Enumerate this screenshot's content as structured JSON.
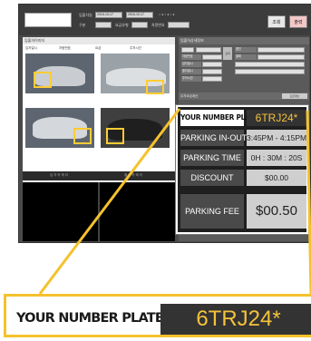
{
  "toolbar": {
    "date_from": "2016-10-17",
    "date_to": "2016-10-17",
    "radio_options": [
      "입차",
      "출차",
      "미정산",
      "정산완료",
      "할인"
    ],
    "search_label": "조회",
    "export_label": "출력"
  },
  "left_panel": {
    "header": "입출차이미지",
    "columns": [
      "입차일시",
      "차량번호",
      "요금",
      "주차시간"
    ]
  },
  "right_panel": {
    "header": "입출차상세정보",
    "field_labels": [
      "차량번호",
      "입차일시",
      "출차일시",
      "주차시간",
      "할인",
      "결제"
    ],
    "section_title": "주차요금계산"
  },
  "receipt": {
    "plate_label": "YOUR NUMBER PLATE",
    "plate_value": "6TRJ24*",
    "in_out_label": "PARKING IN-OUT",
    "in_out_value": "3:45PM - 4:15PM",
    "time_label": "PARKING TIME",
    "time_value": "0H : 30M : 20S",
    "discount_label": "DISCOUNT",
    "discount_value": "$00.00",
    "fee_label": "PARKING FEE",
    "fee_value": "$00.50"
  },
  "zoom": {
    "label": "YOUR NUMBER PLATE",
    "value": "6TRJ24*"
  },
  "colors": {
    "highlight": "#f5c12e",
    "plate_text": "#f4c23a"
  }
}
